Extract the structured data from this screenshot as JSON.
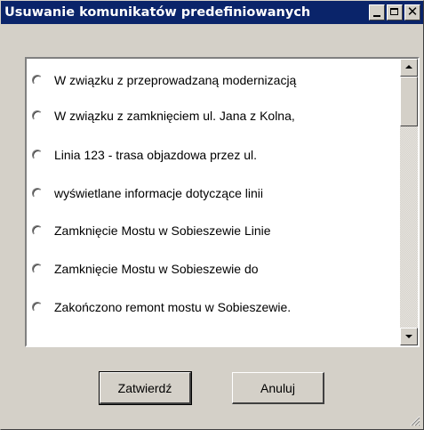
{
  "window": {
    "title": "Usuwanie komunikatów predefiniowanych",
    "titlebar_color": "#0a246a",
    "controls": [
      "minimize-icon",
      "maximize-icon",
      "close-icon"
    ],
    "close_glyph": "✕"
  },
  "list": {
    "items": [
      {
        "label": "W związku z przeprowadzaną modernizacją",
        "selected": false
      },
      {
        "label": "W związku z zamknięciem ul. Jana z Kolna,",
        "selected": false
      },
      {
        "label": "Linia 123 - trasa objazdowa przez ul.",
        "selected": false
      },
      {
        "label": "wyświetlane informacje dotyczące linii",
        "selected": false
      },
      {
        "label": "Zamknięcie Mostu w Sobieszewie Linie",
        "selected": false
      },
      {
        "label": "Zamknięcie Mostu w Sobieszewie do",
        "selected": false
      },
      {
        "label": "Zakończono remont mostu w Sobieszewie.",
        "selected": false
      }
    ],
    "scroll_position": 0
  },
  "buttons": {
    "confirm_label": "Zatwierdź",
    "cancel_label": "Anuluj"
  }
}
